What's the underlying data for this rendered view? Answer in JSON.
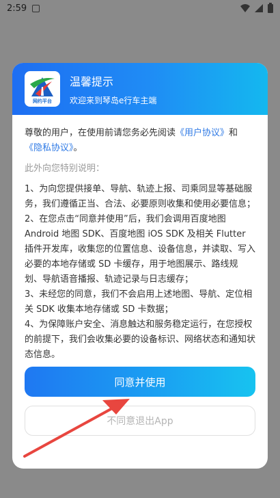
{
  "status_bar": {
    "time": "2:59"
  },
  "dialog": {
    "title": "温馨提示",
    "subtitle": "欢迎来到琴岛e行车主端",
    "logo_text": "网约平台",
    "intro_prefix": "尊敬的用户，在使用前请您务必先阅读",
    "user_agreement": "《用户协议》",
    "and": "和",
    "privacy_policy": "《隐私协议》",
    "intro_suffix": "。",
    "special_note": "此外向您特别说明：",
    "term_1": "1、为向您提供接单、导航、轨迹上报、司乘同显等基础服务，我们遵循正当、合法、必要原则收集和使用必要信息；",
    "term_2": "2、在您点击“同意并使用”后，我们会调用百度地图 Android 地图 SDK、百度地图 iOS SDK 及相关 Flutter 插件开发库，收集您的位置信息、设备信息，并读取、写入必要的本地存储或 SD 卡缓存，用于地图展示、路线规划、导航语音播报、轨迹记录与日志缓存；",
    "term_3": "3、未经您的同意，我们不会启用上述地图、导航、定位相关 SDK 收集本地存储或 SD 卡数据；",
    "term_4": "4、为保障账户安全、消息触达和服务稳定运行，在您授权的前提下，我们会收集必要的设备标识、网络状态和通知状态信息。",
    "agree_button": "同意并使用",
    "decline_button": "不同意退出App"
  },
  "colors": {
    "header_start": "#1e6ef2",
    "header_end": "#14b8ef",
    "link": "#2f7ae5",
    "arrow": "#e8463f"
  }
}
